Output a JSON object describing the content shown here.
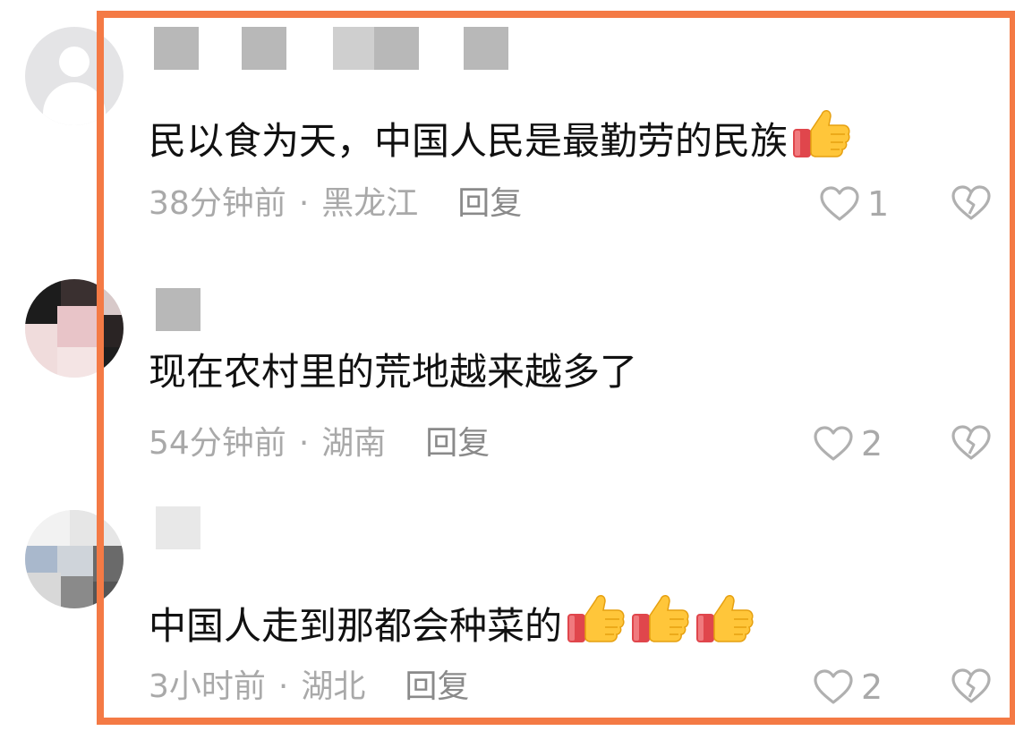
{
  "comments": [
    {
      "avatar": "default-user-avatar",
      "text": "民以食为天，中国人民是最勤劳的民族",
      "emoji_count": 1,
      "time": "38分钟前",
      "location": "黑龙江",
      "reply_label": "回复",
      "likes": "1"
    },
    {
      "avatar": "mosaic-blurred-avatar",
      "text": "现在农村里的荒地越来越多了",
      "emoji_count": 0,
      "time": "54分钟前",
      "location": "湖南",
      "reply_label": "回复",
      "likes": "2"
    },
    {
      "avatar": "mosaic-blurred-avatar",
      "text": "中国人走到那都会种菜的",
      "emoji_count": 3,
      "time": "3小时前",
      "location": "湖北",
      "reply_label": "回复",
      "likes": "2"
    }
  ],
  "separator": "·",
  "icons": {
    "like": "heart-outline-icon",
    "dislike": "broken-heart-icon",
    "emoji": "thumbs-up-emoji"
  },
  "colors": {
    "highlight_frame": "#f47a45",
    "meta_text": "#a9a9a9",
    "body_text": "#111111"
  }
}
